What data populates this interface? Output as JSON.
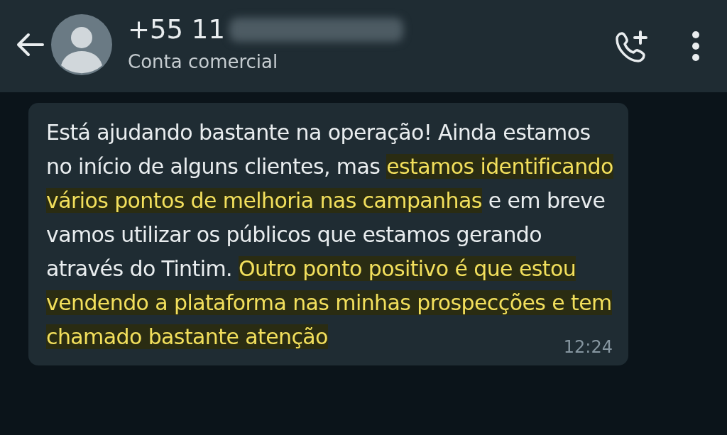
{
  "header": {
    "contact_name": "+55 11",
    "subtitle": "Conta comercial",
    "name_redacted": true
  },
  "message": {
    "segments": [
      {
        "text": "Está ajudando bastante na operação! Ainda estamos no início de alguns clientes, mas ",
        "highlighted": false
      },
      {
        "text": "estamos identificando vários pontos de melhoria nas campanhas",
        "highlighted": true
      },
      {
        "text": " e em breve vamos utilizar os públicos que estamos gerando através do Tintim. ",
        "highlighted": false
      },
      {
        "text": "Outro ponto positivo é que estou vendendo a plataforma nas minhas prospecções e tem chamado bastante atenção",
        "highlighted": true
      }
    ],
    "time": "12:24"
  }
}
